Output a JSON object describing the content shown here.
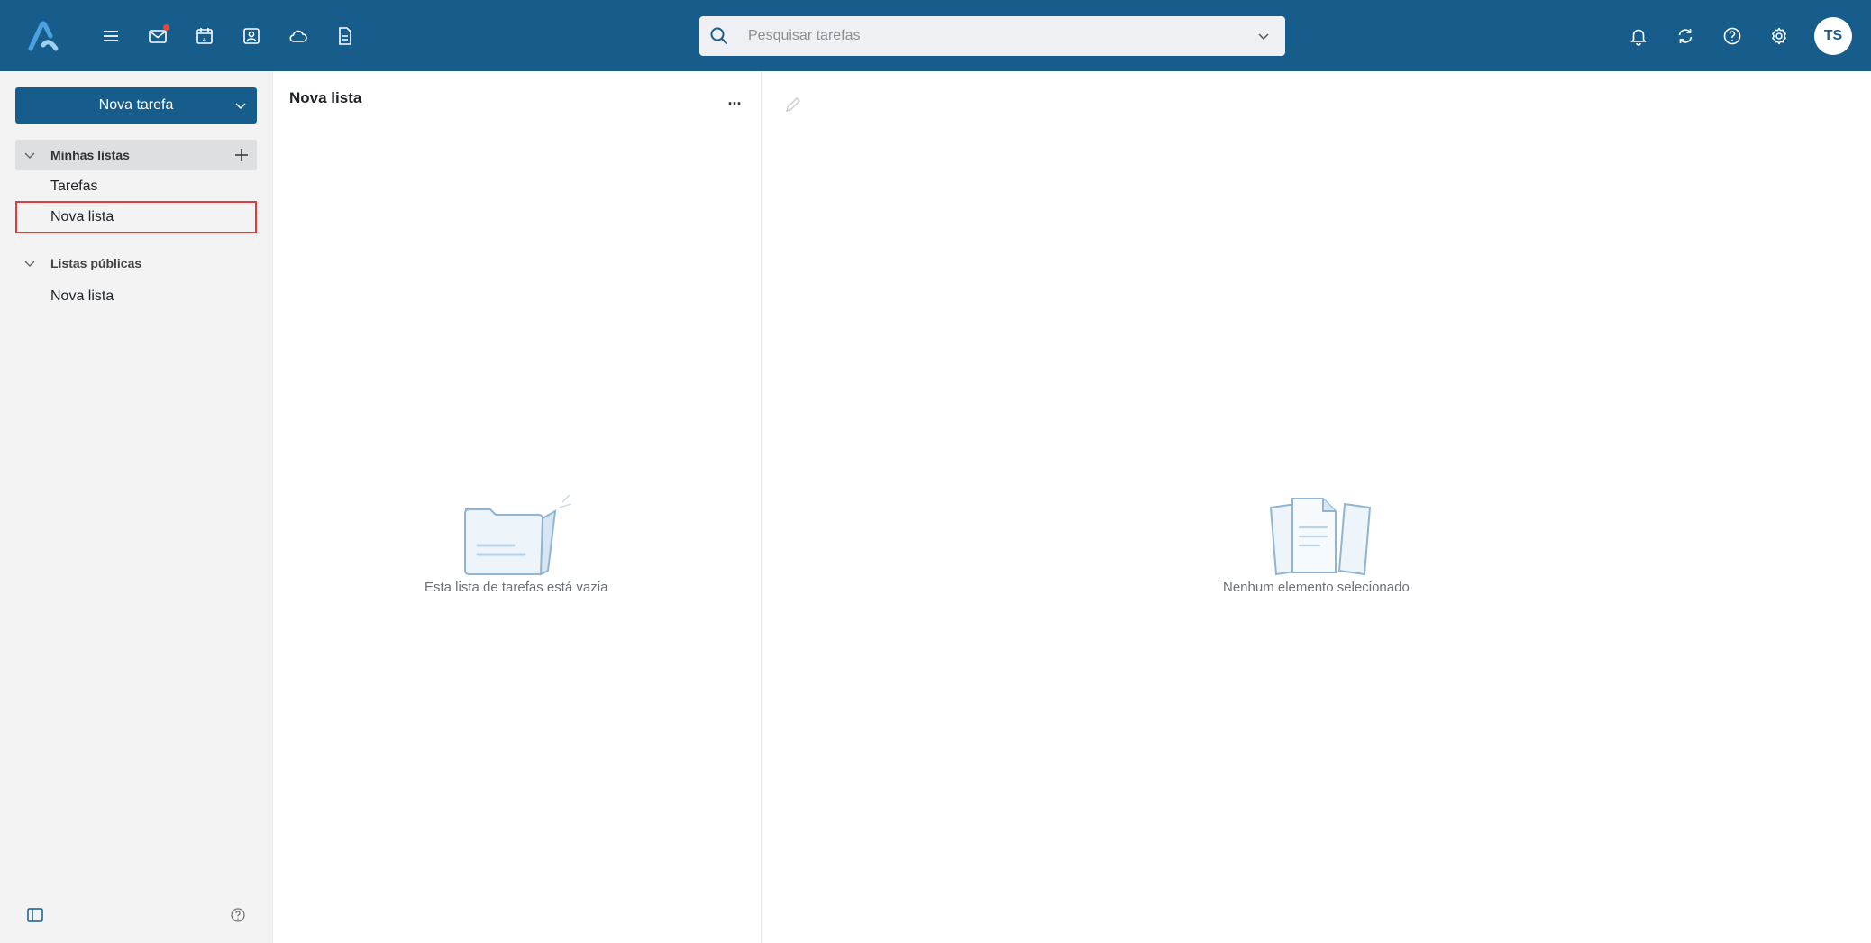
{
  "topbar": {
    "apps": [
      {
        "name": "menu",
        "icon": "hamburger-menu-icon"
      },
      {
        "name": "mail",
        "icon": "mail-icon",
        "has_notification": true
      },
      {
        "name": "calendar",
        "icon": "calendar-icon",
        "calendar_day": "4"
      },
      {
        "name": "contacts",
        "icon": "contacts-icon"
      },
      {
        "name": "drive",
        "icon": "cloud-icon"
      },
      {
        "name": "documents",
        "icon": "document-icon"
      }
    ],
    "search": {
      "placeholder": "Pesquisar tarefas",
      "value": ""
    },
    "right_icons": [
      "bell-icon",
      "refresh-icon",
      "help-icon",
      "settings-icon"
    ],
    "avatar_initials": "TS",
    "colors": {
      "brand": "#165d8c",
      "notification": "#e8463a"
    }
  },
  "sidebar": {
    "new_task_label": "Nova tarefa",
    "my_lists": {
      "label": "Minhas listas",
      "items": [
        {
          "label": "Tarefas"
        },
        {
          "label": "Nova lista",
          "highlighted": true
        }
      ]
    },
    "public_lists": {
      "label": "Listas públicas",
      "items": [
        {
          "label": "Nova lista"
        }
      ]
    },
    "highlight_color": "#e0393e"
  },
  "list_pane": {
    "title": "Nova lista",
    "more_label": "...",
    "empty_text": "Esta lista de tarefas está vazia"
  },
  "detail_pane": {
    "empty_text": "Nenhum elemento selecionado"
  }
}
